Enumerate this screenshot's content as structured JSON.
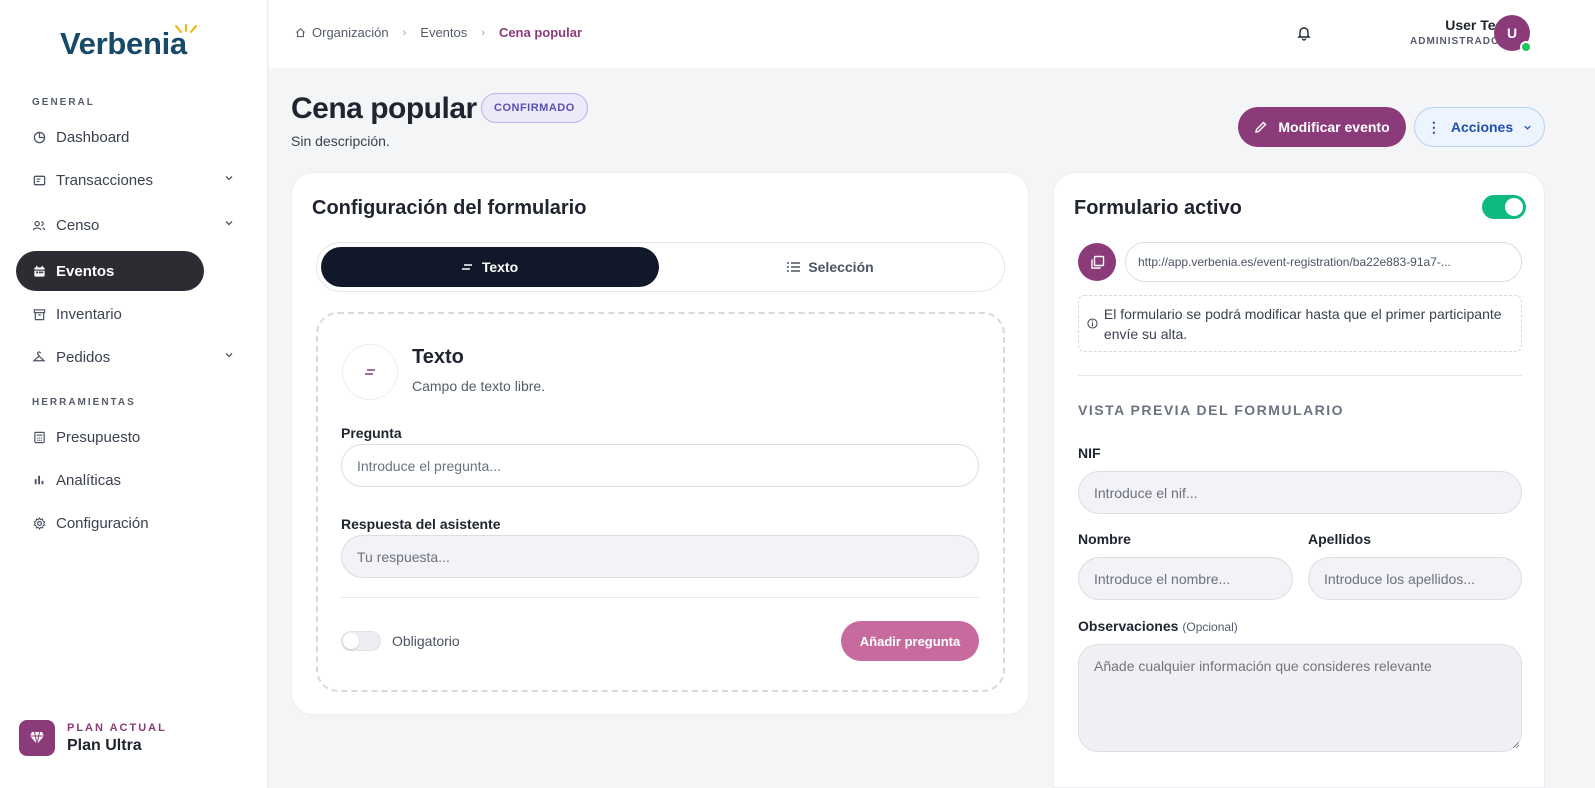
{
  "brand": {
    "logo": "Verbenia",
    "accent": "#8b3a7a"
  },
  "sidebar": {
    "sections": [
      "GENERAL",
      "HERRAMIENTAS"
    ],
    "items": [
      {
        "label": "Dashboard",
        "icon": "pie-chart-icon"
      },
      {
        "label": "Transacciones",
        "icon": "receipt-icon",
        "expandable": true
      },
      {
        "label": "Censo",
        "icon": "users-icon",
        "expandable": true
      },
      {
        "label": "Eventos",
        "icon": "calendar-icon",
        "active": true
      },
      {
        "label": "Inventario",
        "icon": "archive-icon"
      },
      {
        "label": "Pedidos",
        "icon": "hanger-icon",
        "expandable": true
      },
      {
        "label": "Presupuesto",
        "icon": "calculator-icon"
      },
      {
        "label": "Analíticas",
        "icon": "bar-chart-icon"
      },
      {
        "label": "Configuración",
        "icon": "gear-icon"
      }
    ],
    "plan": {
      "label": "PLAN ACTUAL",
      "name": "Plan Ultra"
    }
  },
  "header": {
    "breadcrumb": [
      "Organización",
      "Eventos",
      "Cena popular"
    ],
    "user": {
      "name": "User Test",
      "role": "ADMINISTRADOR",
      "initial": "U"
    }
  },
  "page": {
    "title": "Cena popular",
    "status": "CONFIRMADO",
    "description": "Sin descripción.",
    "edit_button": "Modificar evento",
    "actions_button": "Acciones"
  },
  "form_config": {
    "title": "Configuración del formulario",
    "tabs": [
      "Texto",
      "Selección"
    ],
    "active_tab": 0,
    "question_type": {
      "title": "Texto",
      "subtitle": "Campo de texto libre."
    },
    "question_label": "Pregunta",
    "question_placeholder": "Introduce el pregunta...",
    "answer_label": "Respuesta del asistente",
    "answer_placeholder": "Tu respuesta...",
    "required_label": "Obligatorio",
    "add_button": "Añadir pregunta"
  },
  "active_form": {
    "title": "Formulario activo",
    "enabled": true,
    "url": "http://app.verbenia.es/event-registration/ba22e883-91a7-...",
    "info": "El formulario se podrá modificar hasta que el primer participante envíe su alta.",
    "preview_title": "VISTA PREVIA DEL FORMULARIO",
    "fields": {
      "nif_label": "NIF",
      "nif_placeholder": "Introduce el nif...",
      "name_label": "Nombre",
      "name_placeholder": "Introduce el nombre...",
      "surname_label": "Apellidos",
      "surname_placeholder": "Introduce los apellidos...",
      "notes_label": "Observaciones",
      "notes_optional": "(Opcional)",
      "notes_placeholder": "Añade cualquier información que consideres relevante"
    }
  }
}
